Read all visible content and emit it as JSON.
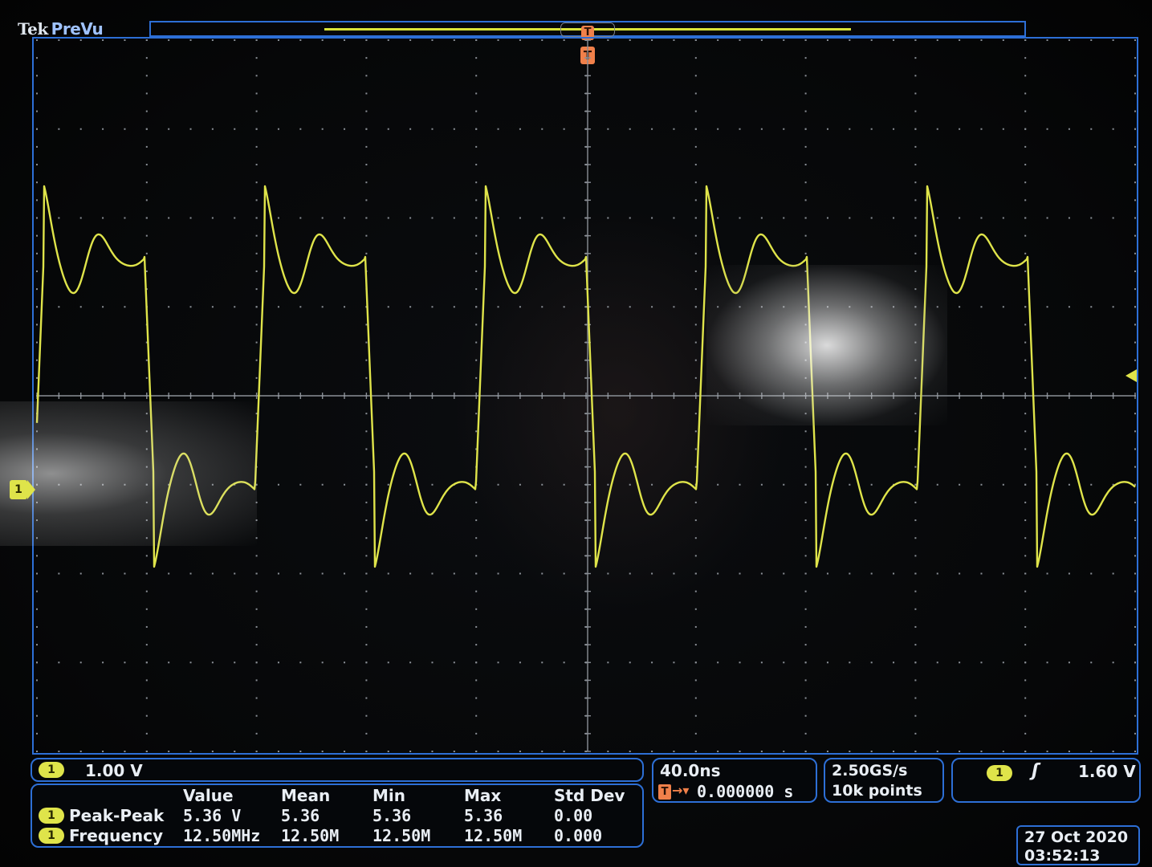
{
  "brand": {
    "maker": "Tek",
    "mode": "PreVu"
  },
  "trigger_position_marker": "T",
  "channel_marker": "1",
  "vertical": {
    "channel": "1",
    "scale": "1.00 V"
  },
  "horizontal": {
    "scale": "40.0ns",
    "position_icon": "T",
    "position_arrow": "→▾",
    "position": "0.000000 s"
  },
  "acquisition": {
    "sample_rate": "2.50GS/s",
    "record_length": "10k points"
  },
  "trigger": {
    "channel": "1",
    "slope_icon": "rising-edge-icon",
    "slope_glyph": "ʃ",
    "level": "1.60 V"
  },
  "datetime": {
    "date": "27 Oct  2020",
    "time": "03:52:13"
  },
  "measurements": {
    "headers": [
      "Value",
      "Mean",
      "Min",
      "Max",
      "Std Dev"
    ],
    "rows": [
      {
        "channel": "1",
        "name": "Peak-Peak",
        "value": "5.36 V",
        "mean": "5.36",
        "min": "5.36",
        "max": "5.36",
        "std_dev": "0.00"
      },
      {
        "channel": "1",
        "name": "Frequency",
        "value": "12.50MHz",
        "mean": "12.50M",
        "min": "12.50M",
        "max": "12.50M",
        "std_dev": "0.000"
      }
    ]
  },
  "colors": {
    "trace": "#dfe44a",
    "frame": "#2d6fd6",
    "trigger": "#f0804a",
    "grid": "#8a8f96"
  }
}
